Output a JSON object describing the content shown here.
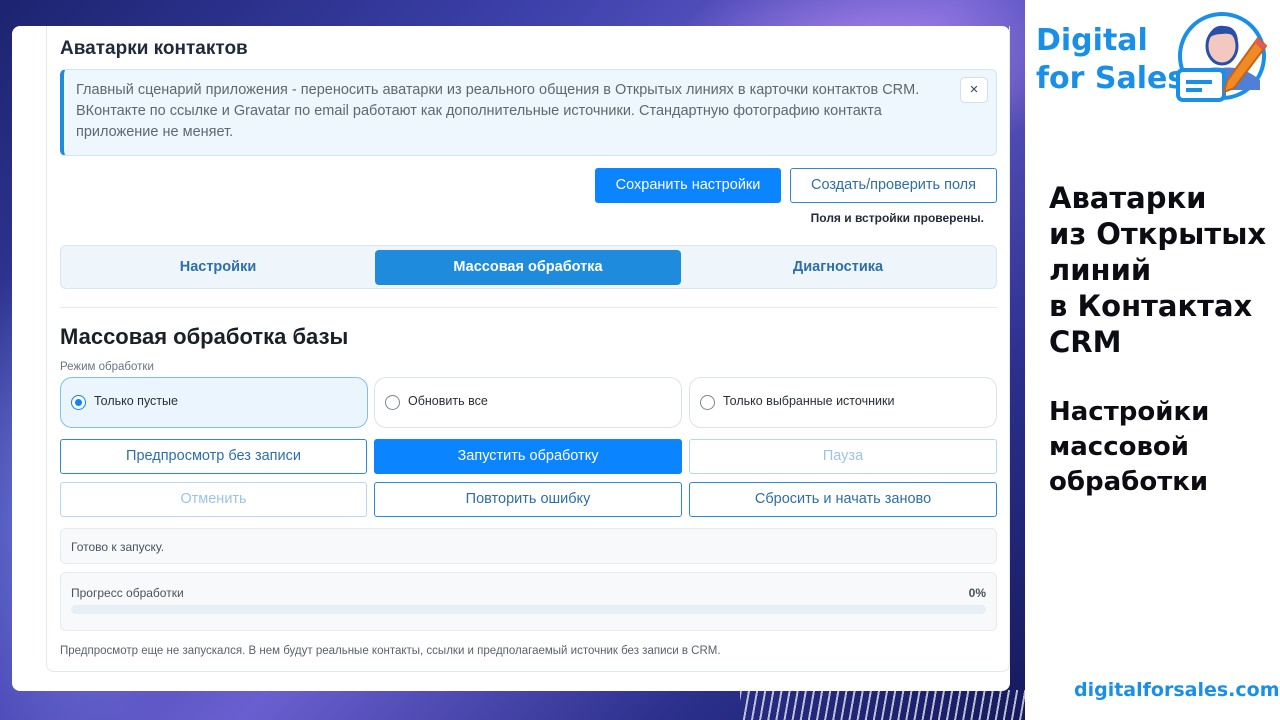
{
  "app": {
    "section_title": "Аватарки контактов",
    "info_text": "Главный сценарий приложения - переносить аватарки из реального общения в Открытых линиях в карточки контактов CRM. ВКонтакте по ссылке и Gravatar по email работают как дополнительные источники. Стандартную фотографию контакта приложение не меняет.",
    "info_close_label": "×",
    "save_button": "Сохранить настройки",
    "check_fields_button": "Создать/проверить поля",
    "fields_status": "Поля и встройки проверены.",
    "tabs": [
      {
        "label": "Настройки",
        "active": false
      },
      {
        "label": "Массовая обработка",
        "active": true
      },
      {
        "label": "Диагностика",
        "active": false
      }
    ],
    "mass_title": "Массовая обработка базы",
    "mode_label": "Режим обработки",
    "modes": [
      {
        "label": "Только пустые",
        "selected": true
      },
      {
        "label": "Обновить все",
        "selected": false
      },
      {
        "label": "Только выбранные источники",
        "selected": false
      }
    ],
    "actions": {
      "preview": "Предпросмотр без записи",
      "start": "Запустить обработку",
      "pause": "Пауза",
      "cancel": "Отменить",
      "retry": "Повторить ошибку",
      "reset": "Сбросить и начать заново"
    },
    "ready_status": "Готово к запуску.",
    "progress_label": "Прогресс обработки",
    "progress_percent_text": "0%",
    "progress_value": 0,
    "footnote": "Предпросмотр еще не запускался. В нем будут реальные контакты, ссылки и предполагаемый источник без записи в CRM."
  },
  "branding": {
    "brand_line1": "Digital",
    "brand_line2": "for Sales",
    "headline": [
      "Аватарки",
      "из Открытых",
      "линий",
      "в Контактах",
      "CRM"
    ],
    "subhead": [
      "Настройки",
      "массовой",
      "обработки"
    ],
    "site": "digitalforsales.com"
  },
  "colors": {
    "accent": "#0a84ff",
    "tab_active": "#1f8bdd",
    "brand_blue": "#1a8fe8"
  },
  "icons": {
    "logo": "person-with-pen-icon",
    "close": "close-icon",
    "radio": "radio-icon"
  }
}
